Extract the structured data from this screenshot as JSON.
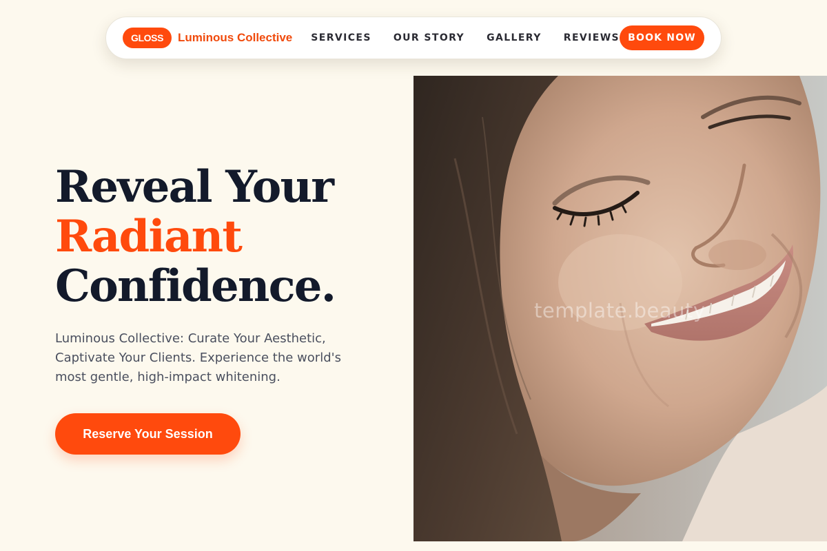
{
  "nav": {
    "logo_text": "GLOSS",
    "brand_name": "Luminous Collective",
    "links": [
      {
        "label": "SERVICES"
      },
      {
        "label": "OUR STORY"
      },
      {
        "label": "GALLERY"
      },
      {
        "label": "REVIEWS"
      }
    ],
    "cta_label": "BOOK NOW"
  },
  "hero": {
    "title_line1": "Reveal Your",
    "title_line2": "Radiant",
    "title_line3": "Confidence.",
    "description": "Luminous Collective: Curate Your Aesthetic, Captivate Your Clients. Experience the world's most gentle, high-impact whitening.",
    "cta_label": "Reserve Your Session",
    "image_watermark": "template.beauty"
  },
  "colors": {
    "accent": "#ff4a0d",
    "heading": "#131a2b",
    "body_text": "#4a4f5e",
    "background": "#fdf9ee"
  }
}
